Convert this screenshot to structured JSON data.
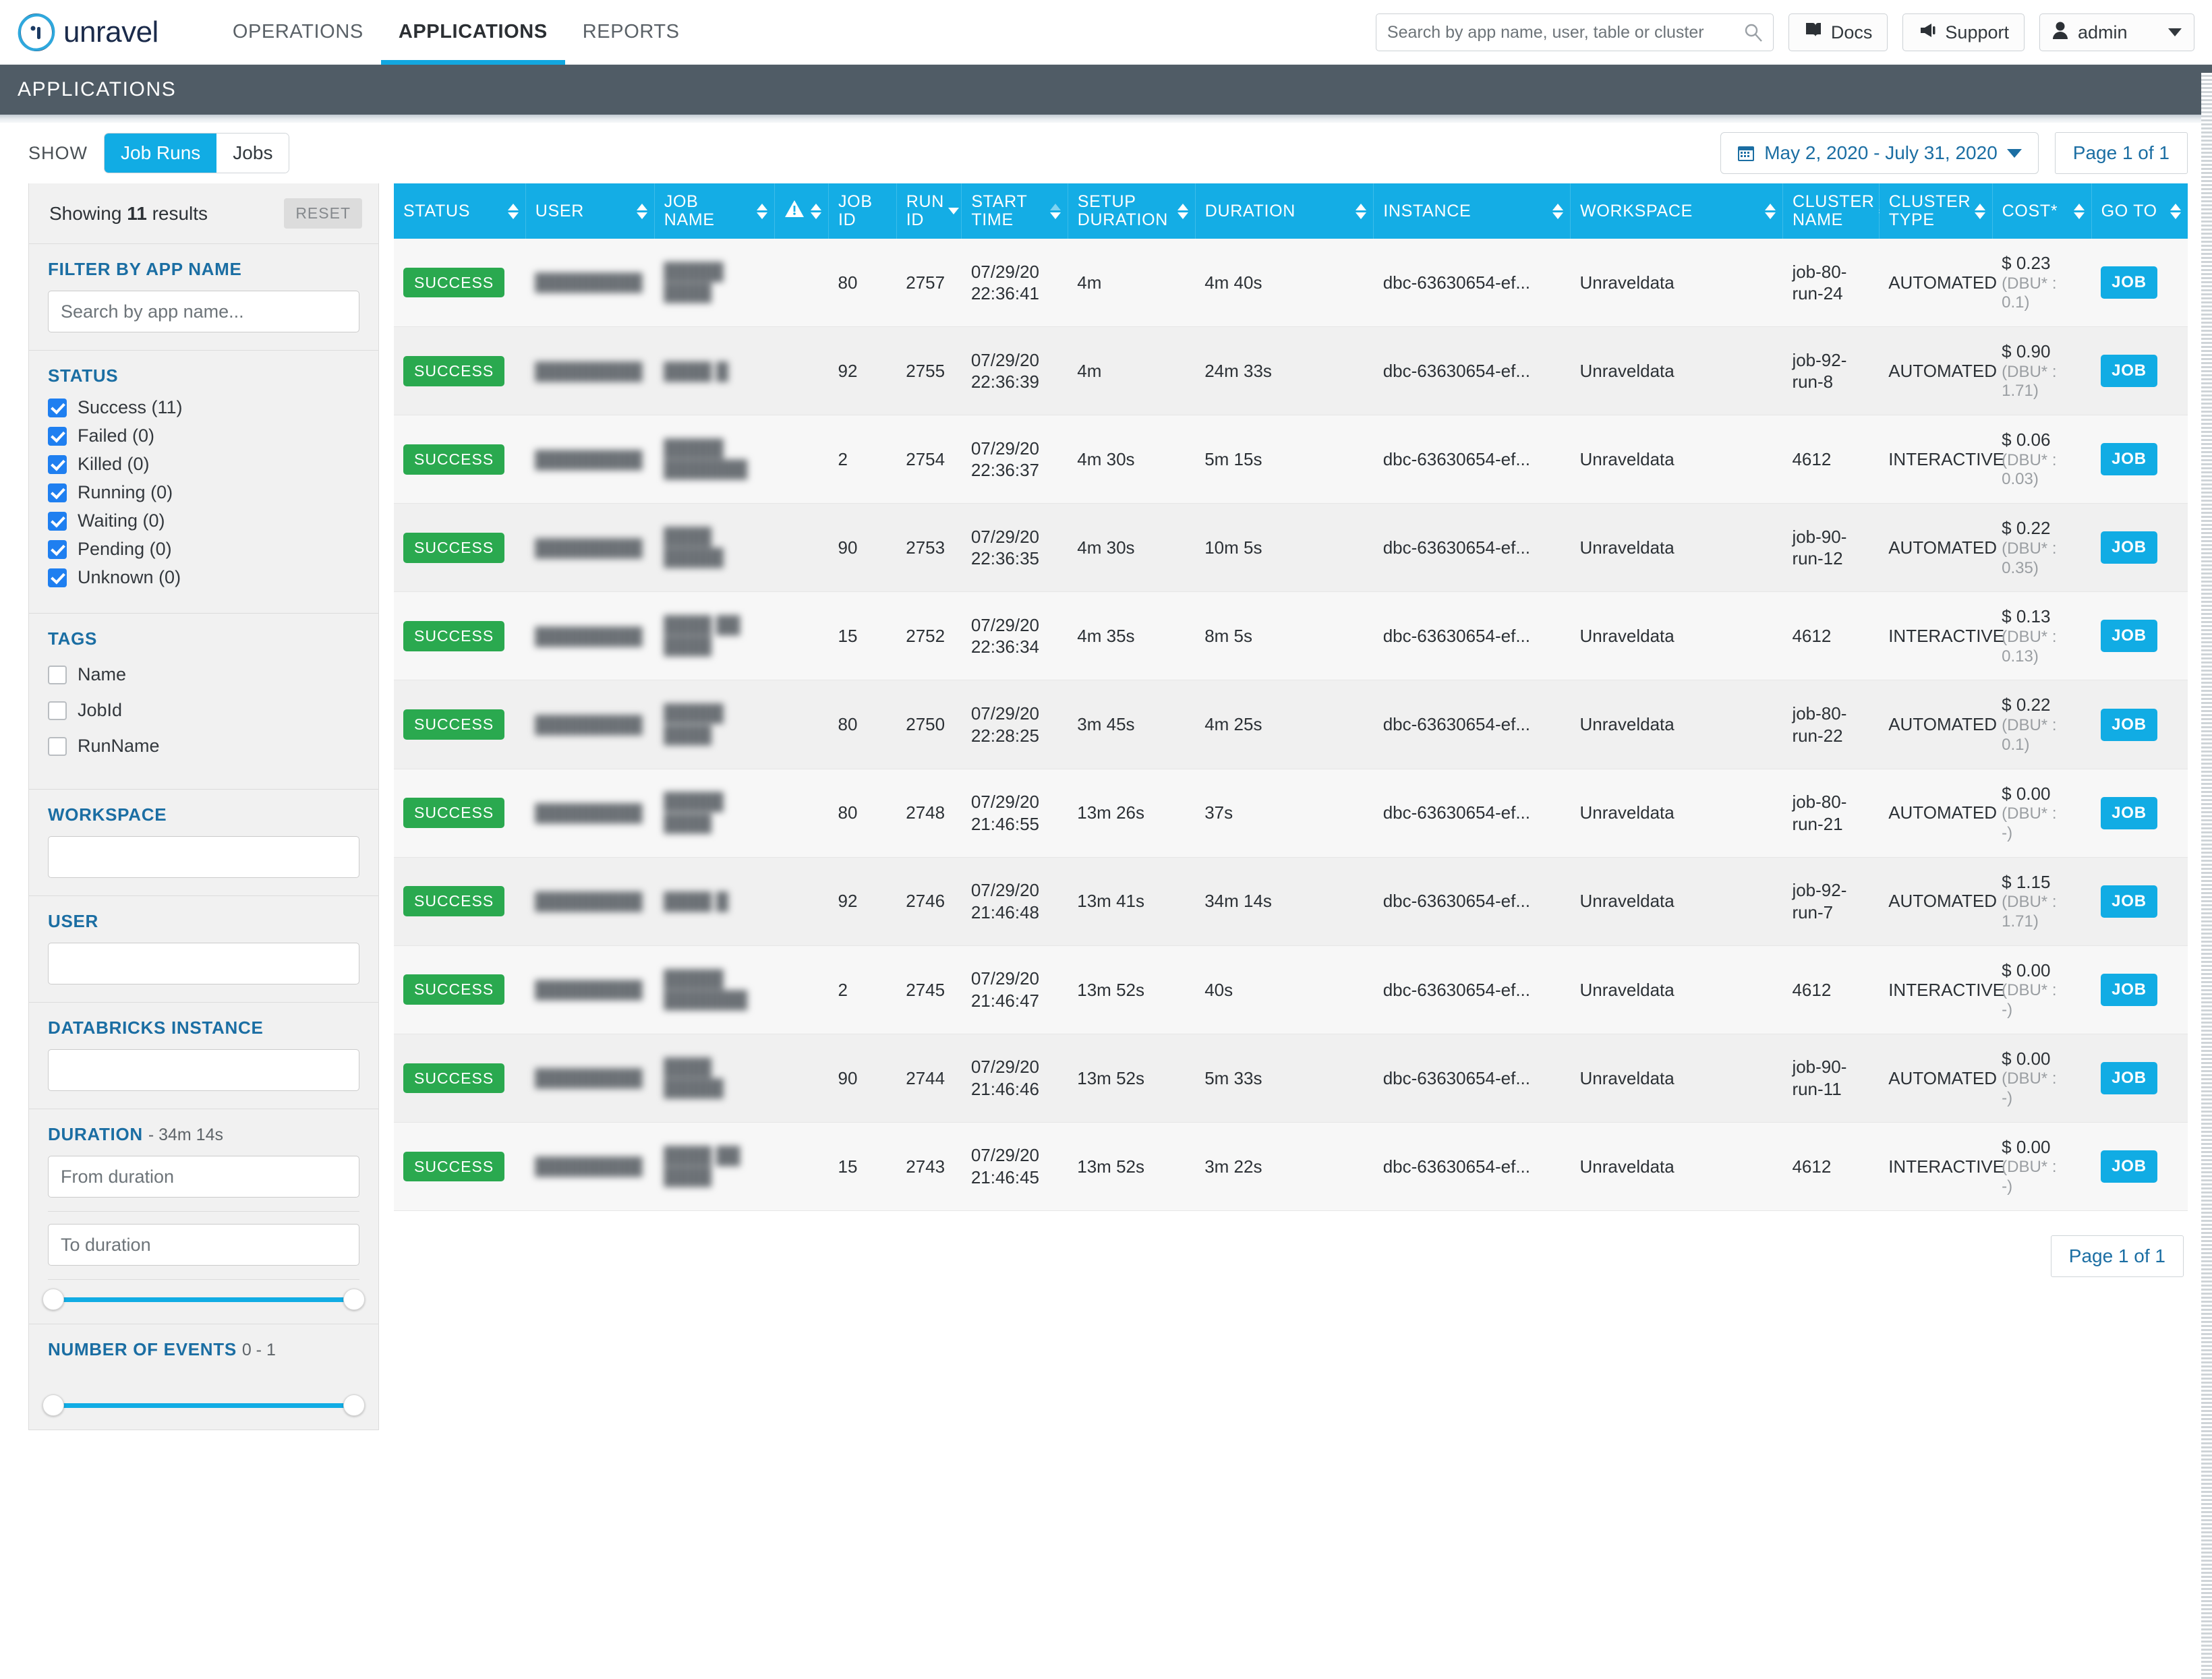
{
  "header": {
    "brand": "unravel",
    "nav": [
      {
        "label": "OPERATIONS",
        "active": false
      },
      {
        "label": "APPLICATIONS",
        "active": true
      },
      {
        "label": "REPORTS",
        "active": false
      }
    ],
    "search_placeholder": "Search by app name, user, table or cluster",
    "docs_label": "Docs",
    "support_label": "Support",
    "user_label": "admin"
  },
  "page_title": "APPLICATIONS",
  "toolbar": {
    "show_label": "SHOW",
    "seg_job_runs": "Job Runs",
    "seg_jobs": "Jobs",
    "date_range": "May 2, 2020 - July 31, 2020",
    "page_indicator": "Page 1 of 1"
  },
  "sidebar": {
    "showing_prefix": "Showing ",
    "showing_count": "11",
    "showing_suffix": " results",
    "reset_label": "RESET",
    "filter_app_name_title": "FILTER BY APP NAME",
    "filter_app_name_placeholder": "Search by app name...",
    "status_title": "STATUS",
    "status_items": [
      {
        "label": "Success (11)",
        "checked": true
      },
      {
        "label": "Failed (0)",
        "checked": true
      },
      {
        "label": "Killed (0)",
        "checked": true
      },
      {
        "label": "Running (0)",
        "checked": true
      },
      {
        "label": "Waiting (0)",
        "checked": true
      },
      {
        "label": "Pending (0)",
        "checked": true
      },
      {
        "label": "Unknown (0)",
        "checked": true
      }
    ],
    "tags_title": "TAGS",
    "tags_items": [
      {
        "label": "Name",
        "checked": false
      },
      {
        "label": "JobId",
        "checked": false
      },
      {
        "label": "RunName",
        "checked": false
      }
    ],
    "workspace_title": "WORKSPACE",
    "workspace_value": "",
    "user_title": "USER",
    "user_value": "",
    "databricks_title": "DATABRICKS INSTANCE",
    "databricks_value": "",
    "duration_title": "DURATION",
    "duration_range": "- 34m 14s",
    "duration_from_placeholder": "From duration",
    "duration_to_placeholder": "To duration",
    "events_title": "NUMBER OF EVENTS",
    "events_range": "0 - 1"
  },
  "table": {
    "columns": [
      {
        "label": "STATUS",
        "icon": ""
      },
      {
        "label": "USER",
        "icon": ""
      },
      {
        "label": "JOB NAME",
        "icon": ""
      },
      {
        "label": "",
        "icon": "warning-icon"
      },
      {
        "label": "JOB\nID",
        "icon": ""
      },
      {
        "label": "RUN\nID",
        "icon": ""
      },
      {
        "label": "START\nTIME",
        "icon": ""
      },
      {
        "label": "SETUP\nDURATION",
        "icon": ""
      },
      {
        "label": "DURATION",
        "icon": ""
      },
      {
        "label": "INSTANCE",
        "icon": ""
      },
      {
        "label": "WORKSPACE",
        "icon": ""
      },
      {
        "label": "CLUSTER\nNAME",
        "icon": ""
      },
      {
        "label": "CLUSTER\nTYPE",
        "icon": ""
      },
      {
        "label": "COST*",
        "icon": ""
      },
      {
        "label": "GO TO",
        "icon": ""
      }
    ],
    "goto_button_label": "JOB",
    "rows": [
      {
        "status": "SUCCESS",
        "user": "█████████",
        "job_name": "█████ ████",
        "job_id": "80",
        "run_id": "2757",
        "start_time": "07/29/20 22:36:41",
        "setup_duration": "4m",
        "duration": "4m 40s",
        "instance": "dbc-63630654-ef...",
        "workspace": "Unraveldata",
        "cluster_name": "job-80-run-24",
        "cluster_type": "AUTOMATED",
        "cost": "$ 0.23",
        "dbu": "(DBU* : 0.1)"
      },
      {
        "status": "SUCCESS",
        "user": "█████████",
        "job_name": "████ █",
        "job_id": "92",
        "run_id": "2755",
        "start_time": "07/29/20 22:36:39",
        "setup_duration": "4m",
        "duration": "24m 33s",
        "instance": "dbc-63630654-ef...",
        "workspace": "Unraveldata",
        "cluster_name": "job-92-run-8",
        "cluster_type": "AUTOMATED",
        "cost": "$ 0.90",
        "dbu": "(DBU* : 1.71)"
      },
      {
        "status": "SUCCESS",
        "user": "█████████",
        "job_name": "█████ ███████",
        "job_id": "2",
        "run_id": "2754",
        "start_time": "07/29/20 22:36:37",
        "setup_duration": "4m 30s",
        "duration": "5m 15s",
        "instance": "dbc-63630654-ef...",
        "workspace": "Unraveldata",
        "cluster_name": "4612",
        "cluster_type": "INTERACTIVE",
        "cost": "$ 0.06",
        "dbu": "(DBU* : 0.03)"
      },
      {
        "status": "SUCCESS",
        "user": "█████████",
        "job_name": "████ █████",
        "job_id": "90",
        "run_id": "2753",
        "start_time": "07/29/20 22:36:35",
        "setup_duration": "4m 30s",
        "duration": "10m 5s",
        "instance": "dbc-63630654-ef...",
        "workspace": "Unraveldata",
        "cluster_name": "job-90-run-12",
        "cluster_type": "AUTOMATED",
        "cost": "$ 0.22",
        "dbu": "(DBU* : 0.35)"
      },
      {
        "status": "SUCCESS",
        "user": "█████████",
        "job_name": "████ ██ ████",
        "job_id": "15",
        "run_id": "2752",
        "start_time": "07/29/20 22:36:34",
        "setup_duration": "4m 35s",
        "duration": "8m 5s",
        "instance": "dbc-63630654-ef...",
        "workspace": "Unraveldata",
        "cluster_name": "4612",
        "cluster_type": "INTERACTIVE",
        "cost": "$ 0.13",
        "dbu": "(DBU* : 0.13)"
      },
      {
        "status": "SUCCESS",
        "user": "█████████",
        "job_name": "█████ ████",
        "job_id": "80",
        "run_id": "2750",
        "start_time": "07/29/20 22:28:25",
        "setup_duration": "3m 45s",
        "duration": "4m 25s",
        "instance": "dbc-63630654-ef...",
        "workspace": "Unraveldata",
        "cluster_name": "job-80-run-22",
        "cluster_type": "AUTOMATED",
        "cost": "$ 0.22",
        "dbu": "(DBU* : 0.1)"
      },
      {
        "status": "SUCCESS",
        "user": "█████████",
        "job_name": "█████ ████",
        "job_id": "80",
        "run_id": "2748",
        "start_time": "07/29/20 21:46:55",
        "setup_duration": "13m 26s",
        "duration": "37s",
        "instance": "dbc-63630654-ef...",
        "workspace": "Unraveldata",
        "cluster_name": "job-80-run-21",
        "cluster_type": "AUTOMATED",
        "cost": "$ 0.00",
        "dbu": "(DBU* : -)"
      },
      {
        "status": "SUCCESS",
        "user": "█████████",
        "job_name": "████ █",
        "job_id": "92",
        "run_id": "2746",
        "start_time": "07/29/20 21:46:48",
        "setup_duration": "13m 41s",
        "duration": "34m 14s",
        "instance": "dbc-63630654-ef...",
        "workspace": "Unraveldata",
        "cluster_name": "job-92-run-7",
        "cluster_type": "AUTOMATED",
        "cost": "$ 1.15",
        "dbu": "(DBU* : 1.71)"
      },
      {
        "status": "SUCCESS",
        "user": "█████████",
        "job_name": "█████ ███████",
        "job_id": "2",
        "run_id": "2745",
        "start_time": "07/29/20 21:46:47",
        "setup_duration": "13m 52s",
        "duration": "40s",
        "instance": "dbc-63630654-ef...",
        "workspace": "Unraveldata",
        "cluster_name": "4612",
        "cluster_type": "INTERACTIVE",
        "cost": "$ 0.00",
        "dbu": "(DBU* : -)"
      },
      {
        "status": "SUCCESS",
        "user": "█████████",
        "job_name": "████ █████",
        "job_id": "90",
        "run_id": "2744",
        "start_time": "07/29/20 21:46:46",
        "setup_duration": "13m 52s",
        "duration": "5m 33s",
        "instance": "dbc-63630654-ef...",
        "workspace": "Unraveldata",
        "cluster_name": "job-90-run-11",
        "cluster_type": "AUTOMATED",
        "cost": "$ 0.00",
        "dbu": "(DBU* : -)"
      },
      {
        "status": "SUCCESS",
        "user": "█████████",
        "job_name": "████ ██ ████",
        "job_id": "15",
        "run_id": "2743",
        "start_time": "07/29/20 21:46:45",
        "setup_duration": "13m 52s",
        "duration": "3m 22s",
        "instance": "dbc-63630654-ef...",
        "workspace": "Unraveldata",
        "cluster_name": "4612",
        "cluster_type": "INTERACTIVE",
        "cost": "$ 0.00",
        "dbu": "(DBU* : -)"
      }
    ]
  },
  "footer": {
    "page_indicator": "Page 1 of 1"
  },
  "colors": {
    "accent_blue": "#11ace4",
    "header_blue": "#14ade5",
    "title_bar": "#505c66",
    "success_green": "#2aa94f",
    "link_blue": "#1b6ea3"
  }
}
